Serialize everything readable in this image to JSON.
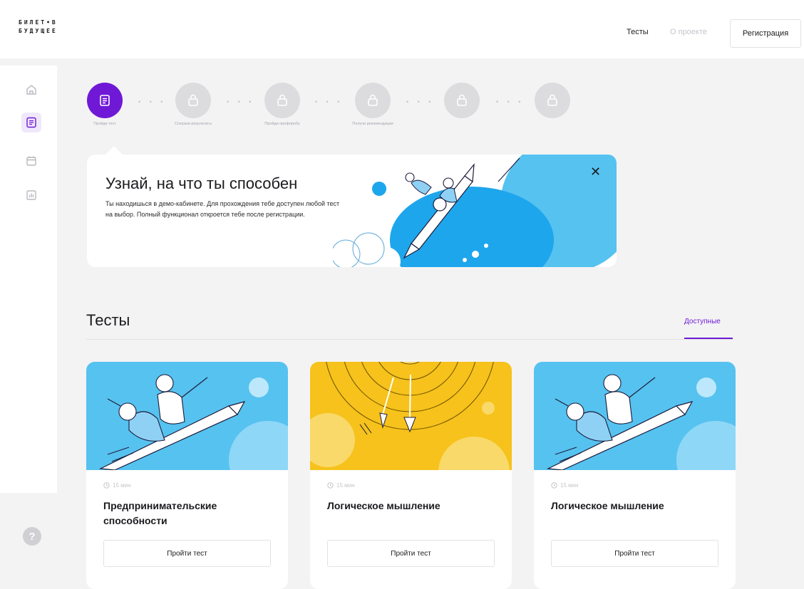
{
  "header": {
    "logo_line1": "БИЛЕТ•В",
    "logo_line2": "БУДУЩЕЕ",
    "nav_tests": "Тесты",
    "nav_about": "О проекте",
    "register_label": "Регистрация"
  },
  "sidebar": {
    "items": [
      {
        "icon": "home-icon",
        "active": false
      },
      {
        "icon": "tests-list-icon",
        "active": true
      },
      {
        "icon": "calendar-icon",
        "active": false
      },
      {
        "icon": "stats-icon",
        "active": false
      }
    ],
    "help_label": "?"
  },
  "steps": [
    {
      "label": "Пройди тест",
      "active": true,
      "icon": "test-icon"
    },
    {
      "label": "Сохрани результаты",
      "active": false,
      "icon": "lock-icon"
    },
    {
      "label": "Пройди профпробу",
      "active": false,
      "icon": "lock-icon"
    },
    {
      "label": "Получи рекомендации",
      "active": false,
      "icon": "lock-icon"
    },
    {
      "label": "",
      "active": false,
      "icon": "lock-icon"
    },
    {
      "label": "",
      "active": false,
      "icon": "lock-icon"
    }
  ],
  "banner": {
    "title": "Узнай, на что ты способен",
    "text": "Ты находишься в демо-кабинете. Для прохождения тебе доступен любой тест на выбор. Полный функционал откроется тебе после регистрации.",
    "close_icon": "close-icon"
  },
  "tests_section": {
    "title": "Тесты",
    "tab_available": "Доступные"
  },
  "cards": [
    {
      "time": "15 мин",
      "title": "Предпринимательские способности",
      "button": "Пройти тест",
      "image": "pencil-rocket-illustration"
    },
    {
      "time": "15 мин",
      "title": "Логическое мышление",
      "button": "Пройти тест",
      "image": "darts-target-illustration"
    },
    {
      "time": "15 мин",
      "title": "Логическое мышление",
      "button": "Пройти тест",
      "image": "pencil-rocket-illustration"
    }
  ],
  "colors": {
    "accent": "#6f19d6",
    "sky_blue": "#56c2f0",
    "yellow": "#f6c21b",
    "background": "#f3f3f4"
  }
}
